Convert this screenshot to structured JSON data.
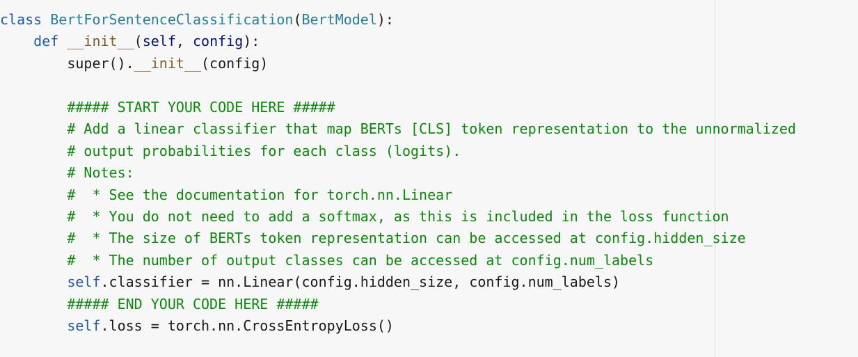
{
  "editor": {
    "lines": [
      [
        {
          "text": "class ",
          "role": "kw"
        },
        {
          "text": "BertForSentenceClassification",
          "role": "cls"
        },
        {
          "text": "(",
          "role": "plain"
        },
        {
          "text": "BertModel",
          "role": "cls"
        },
        {
          "text": "):",
          "role": "plain"
        }
      ],
      [
        {
          "text": "    ",
          "role": "plain"
        },
        {
          "text": "def ",
          "role": "kw"
        },
        {
          "text": "__init__",
          "role": "fn"
        },
        {
          "text": "(",
          "role": "plain"
        },
        {
          "text": "self",
          "role": "param"
        },
        {
          "text": ", ",
          "role": "plain"
        },
        {
          "text": "config",
          "role": "param"
        },
        {
          "text": "):",
          "role": "plain"
        }
      ],
      [
        {
          "text": "        ",
          "role": "plain"
        },
        {
          "text": "super",
          "role": "plain"
        },
        {
          "text": "().",
          "role": "plain"
        },
        {
          "text": "__init__",
          "role": "fn"
        },
        {
          "text": "(config)",
          "role": "plain"
        }
      ],
      [
        {
          "text": "",
          "role": "plain"
        }
      ],
      [
        {
          "text": "        ",
          "role": "plain"
        },
        {
          "text": "##### START YOUR CODE HERE #####",
          "role": "comment"
        }
      ],
      [
        {
          "text": "        ",
          "role": "plain"
        },
        {
          "text": "# Add a linear classifier that map BERTs [CLS] token representation to the unnormalized",
          "role": "comment"
        }
      ],
      [
        {
          "text": "        ",
          "role": "plain"
        },
        {
          "text": "# output probabilities for each class (logits).",
          "role": "comment"
        }
      ],
      [
        {
          "text": "        ",
          "role": "plain"
        },
        {
          "text": "# Notes:",
          "role": "comment"
        }
      ],
      [
        {
          "text": "        ",
          "role": "plain"
        },
        {
          "text": "#  * See the documentation for torch.nn.Linear",
          "role": "comment"
        }
      ],
      [
        {
          "text": "        ",
          "role": "plain"
        },
        {
          "text": "#  * You do not need to add a softmax, as this is included in the loss function",
          "role": "comment"
        }
      ],
      [
        {
          "text": "        ",
          "role": "plain"
        },
        {
          "text": "#  * The size of BERTs token representation can be accessed at config.hidden_size",
          "role": "comment"
        }
      ],
      [
        {
          "text": "        ",
          "role": "plain"
        },
        {
          "text": "#  * The number of output classes can be accessed at config.num_labels",
          "role": "comment"
        }
      ],
      [
        {
          "text": "        ",
          "role": "plain"
        },
        {
          "text": "self",
          "role": "self"
        },
        {
          "text": ".classifier = nn.Linear(config.hidden_size, config.num_labels)",
          "role": "plain"
        }
      ],
      [
        {
          "text": "        ",
          "role": "plain"
        },
        {
          "text": "##### END YOUR CODE HERE #####",
          "role": "comment"
        }
      ],
      [
        {
          "text": "        ",
          "role": "plain"
        },
        {
          "text": "self",
          "role": "self"
        },
        {
          "text": ".loss = torch.nn.CrossEntropyLoss()",
          "role": "plain"
        }
      ]
    ]
  }
}
